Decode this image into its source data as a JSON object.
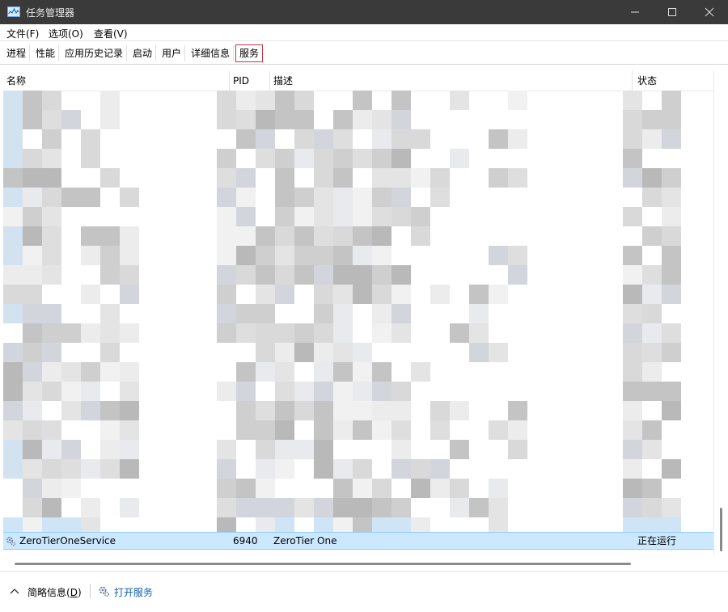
{
  "window": {
    "title": "任务管理器",
    "accent": "#c4344a",
    "selected_bg": "#cce8ff"
  },
  "menu": [
    {
      "label": "文件(F)"
    },
    {
      "label": "选项(O)"
    },
    {
      "label": "查看(V)"
    }
  ],
  "tabs": [
    {
      "label": "进程"
    },
    {
      "label": "性能"
    },
    {
      "label": "应用历史记录"
    },
    {
      "label": "启动"
    },
    {
      "label": "用户"
    },
    {
      "label": "详细信息"
    },
    {
      "label": "服务",
      "active": true
    }
  ],
  "table": {
    "columns": [
      {
        "label": "名称"
      },
      {
        "label": "PID"
      },
      {
        "label": "描述"
      },
      {
        "label": "状态"
      }
    ],
    "selected_row": {
      "name": "ZeroTierOneService",
      "pid": "6940",
      "description": "ZeroTier One",
      "status": "正在运行"
    }
  },
  "footer": {
    "brief_text": "简略信息(",
    "brief_key": "D",
    "brief_close": ")",
    "open_services": "打开服务"
  },
  "icons": {
    "app": "task-manager-icon",
    "minimize": "minimize-icon",
    "maximize": "maximize-icon",
    "close": "close-icon",
    "service": "gear-icon",
    "footer_toggle": "chevron-up-icon"
  }
}
